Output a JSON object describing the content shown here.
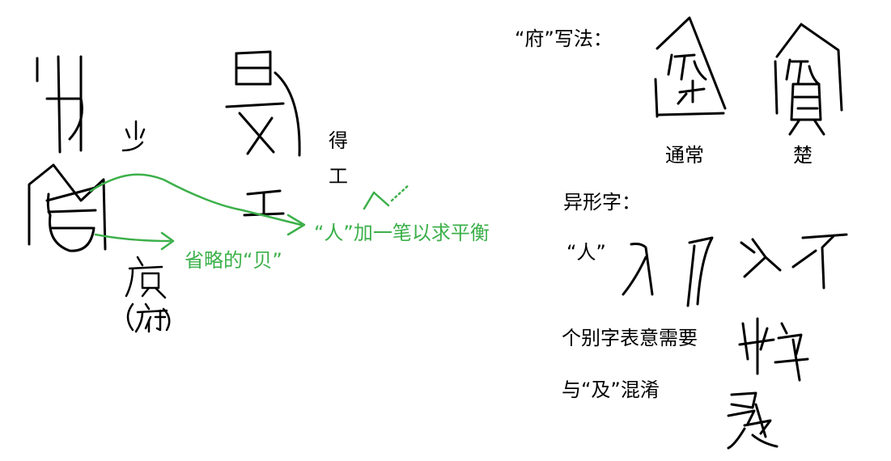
{
  "notes": {
    "fu_label": "“府”写法：",
    "tongchang": "通常",
    "chu": "楚",
    "yixingzi": "异形字：",
    "ren_quote": "“人”",
    "gebie": "个别字表意需要",
    "yu_ji": "与“及”混淆",
    "de": "得",
    "gong": "工",
    "shenglue": "省略的“贝”",
    "ren_jia": "“人”加一笔以求平衡"
  },
  "colors": {
    "ink": "#000000",
    "annotation": "#3cb04a"
  }
}
